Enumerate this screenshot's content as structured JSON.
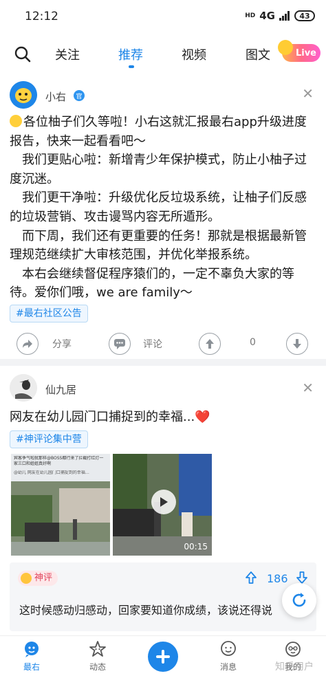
{
  "status_bar": {
    "time": "12:12",
    "hd": "HD",
    "network": "4G",
    "battery": "43"
  },
  "top_nav": {
    "tabs": [
      {
        "label": "关注",
        "active": false
      },
      {
        "label": "推荐",
        "active": true
      },
      {
        "label": "视频",
        "active": false
      },
      {
        "label": "图文",
        "active": false
      }
    ],
    "live_label": "Live",
    "accent_color": "#1e86e8"
  },
  "post1": {
    "author": "小右",
    "official_badge": "官",
    "paragraphs": [
      "各位柚子们久等啦！小右这就汇报最右app升级进度报告，快来一起看看吧～",
      "　我们更贴心啦：新增青少年保护模式，防止小柚子过度沉迷。",
      "　我们更干净啦：升级优化反垃圾系统，让柚子们反感的垃圾营销、攻击谩骂内容无所遁形。",
      "　而下周，我们还有更重要的任务！那就是根据最新管理规范继续扩大审核范围，并优化举报系统。",
      "　本右会继续督促程序猿们的，一定不辜负大家的等待。爱你们哦，we are family～"
    ],
    "hashtag": "#最右社区公告",
    "actions": {
      "share": "分享",
      "comment": "评论",
      "votes": "0"
    }
  },
  "post2": {
    "author": "仙九居",
    "title": "网友在幼儿园门口捕捉到的幸福...",
    "title_emoji": "❤️",
    "hashtag": "#神评论集中营",
    "thumb1_caption": "宾客争气啦就那样@BOSS都行来了拦截打红灯一家三口和姐姐真好啊",
    "thumb1_sub": "@幼儿 网友在幼儿园门口捕捉到的幸福…",
    "video_duration": "00:15",
    "god_comment": {
      "badge": "神评",
      "upvotes": "186",
      "text": "这时候感动归感动，回家要知道你成绩，该说还得说"
    }
  },
  "bottom_nav": {
    "items": [
      {
        "label": "最右",
        "icon": "zuiyou-home-icon",
        "active": true
      },
      {
        "label": "动态",
        "icon": "star-icon",
        "active": false
      },
      {
        "label": "消息",
        "icon": "message-icon",
        "active": false
      },
      {
        "label": "我的",
        "icon": "profile-icon",
        "active": false
      }
    ],
    "watermark": "知乎用户"
  }
}
